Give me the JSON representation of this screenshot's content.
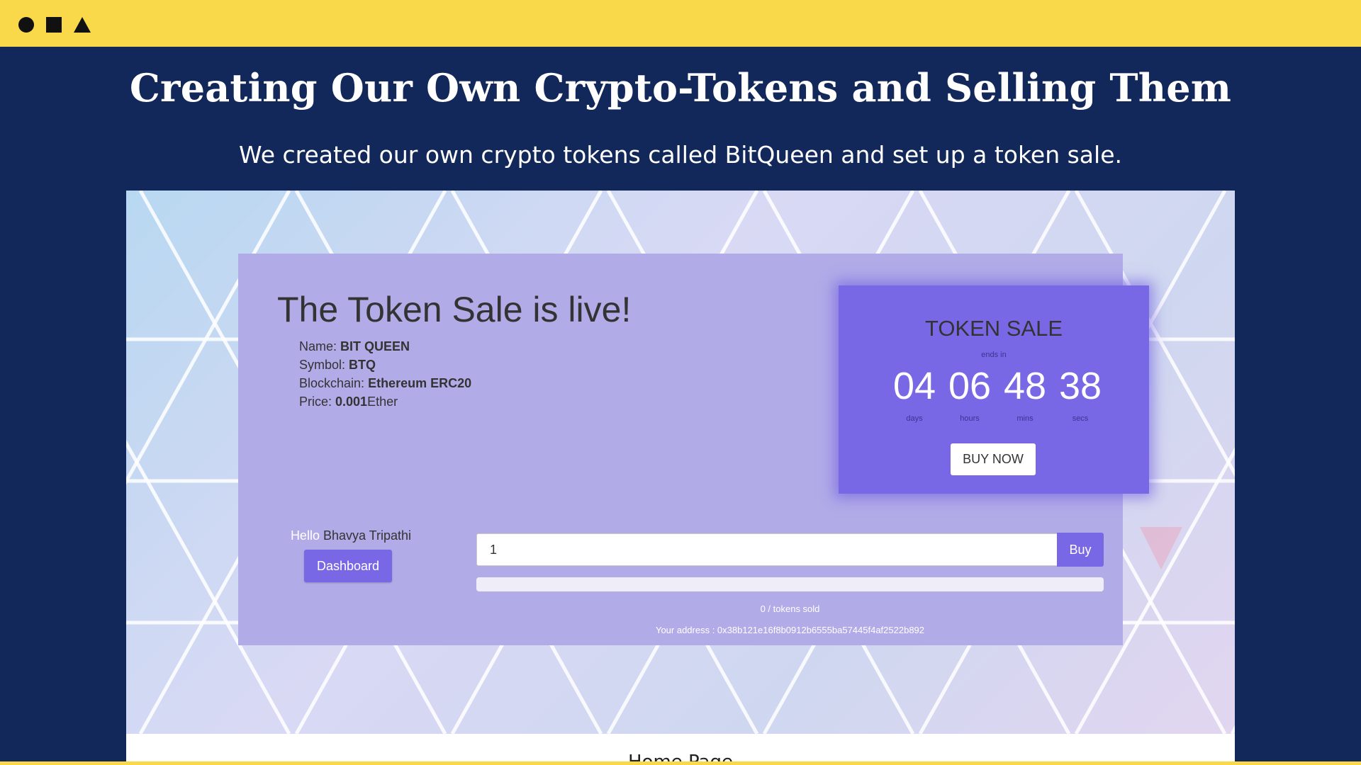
{
  "hero": {
    "title": "Creating Our Own Crypto-Tokens and Selling Them",
    "subtitle": "We created our own crypto tokens called BitQueen and set up a token sale."
  },
  "token_sale": {
    "heading": "The Token Sale is live!",
    "name_label": "Name: ",
    "name_value": "BIT QUEEN",
    "symbol_label": "Symbol: ",
    "symbol_value": "BTQ",
    "blockchain_label": "Blockchain: ",
    "blockchain_value": "Ethereum ERC20",
    "price_label": "Price: ",
    "price_value": "0.001",
    "price_unit": "Ether"
  },
  "user": {
    "hello": "Hello",
    "name": " Bhavya Tripathi",
    "dashboard_label": "Dashboard"
  },
  "purchase": {
    "quantity_value": "1",
    "buy_label": "Buy",
    "progress_fraction": 0,
    "tokens_sold_text": "0 / tokens sold",
    "address_text": "Your address : 0x38b121e16f8b0912b6555ba57445f4af2522b892"
  },
  "countdown": {
    "title": "TOKEN SALE",
    "ends_in": "ends in",
    "units": [
      {
        "value": "04",
        "label": "days"
      },
      {
        "value": "06",
        "label": "hours"
      },
      {
        "value": "48",
        "label": "mins"
      },
      {
        "value": "38",
        "label": "secs"
      }
    ],
    "buy_now_label": "BUY NOW"
  },
  "footer": {
    "partial_text": "Home Page"
  },
  "colors": {
    "page_bg": "#13285a",
    "topbar": "#f9d84a",
    "panel": "#b1abe8",
    "accent": "#7868e6"
  }
}
